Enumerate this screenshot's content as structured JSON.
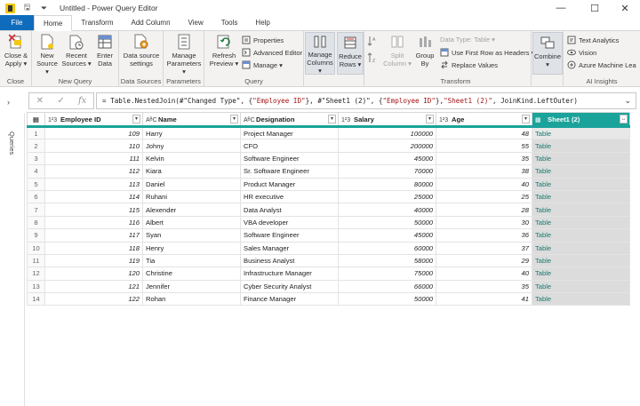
{
  "window": {
    "title": "Untitled - Power Query Editor",
    "minimize": "—",
    "maximize": "☐",
    "close": "✕"
  },
  "tabs": [
    {
      "label": "File"
    },
    {
      "label": "Home"
    },
    {
      "label": "Transform"
    },
    {
      "label": "Add Column"
    },
    {
      "label": "View"
    },
    {
      "label": "Tools"
    },
    {
      "label": "Help"
    }
  ],
  "ribbon": {
    "close_group": {
      "label": "Close",
      "close_apply": "Close &",
      "close_apply2": "Apply ▾"
    },
    "new_query_group": {
      "label": "New Query",
      "new_source": "New",
      "new_source2": "Source ▾",
      "recent": "Recent",
      "recent2": "Sources ▾",
      "enter": "Enter",
      "enter2": "Data"
    },
    "data_sources_group": {
      "label": "Data Sources",
      "settings": "Data source",
      "settings2": "settings"
    },
    "parameters_group": {
      "label": "Parameters",
      "manage": "Manage",
      "manage2": "Parameters ▾"
    },
    "query_group": {
      "label": "Query",
      "refresh": "Refresh",
      "refresh2": "Preview ▾",
      "properties": "Properties",
      "advanced": "Advanced Editor",
      "manage": "Manage ▾"
    },
    "manage_columns": {
      "l1": "Manage",
      "l2": "Columns ▾"
    },
    "reduce_rows": {
      "l1": "Reduce",
      "l2": "Rows ▾"
    },
    "transform_group": {
      "label": "Transform",
      "split": "Split",
      "split2": "Column ▾",
      "group": "Group",
      "group2": "By",
      "data_type": "Data Type: Table ▾",
      "first_row": "Use First Row as Headers ▾",
      "replace": "Replace Values"
    },
    "combine": {
      "l1": "Combine",
      "l2": "▾"
    },
    "ai_group": {
      "label": "AI Insights",
      "text_analytics": "Text Analytics",
      "vision": "Vision",
      "azure_ml": "Azure Machine Lea"
    }
  },
  "formula_bar": {
    "cancel": "✕",
    "accept": "✓",
    "fx": "fx",
    "p1": "= Table.NestedJoin(#\"Changed Type\", {",
    "s1": "\"Employee ID\"",
    "p2": "}, #\"Sheet1 (2)\", {",
    "s2": "\"Employee ID\"",
    "p3": "}, ",
    "s3": "\"Sheet1 (2)\"",
    "p4": ", JoinKind.LeftOuter)"
  },
  "side_panel": {
    "toggle": "›",
    "label": "Queries"
  },
  "grid": {
    "columns": [
      {
        "type": "1²3",
        "name": "Employee ID"
      },
      {
        "type": "AᴮC",
        "name": "Name"
      },
      {
        "type": "AᴮC",
        "name": "Designation"
      },
      {
        "type": "1²3",
        "name": "Salary"
      },
      {
        "type": "1²3",
        "name": "Age"
      },
      {
        "type": "▦",
        "name": "Sheet1 (2)"
      }
    ],
    "rows": [
      {
        "n": "1",
        "id": "109",
        "name": "Harry",
        "designation": "Project Manager",
        "salary": "100000",
        "age": "48",
        "sheet": "Table"
      },
      {
        "n": "2",
        "id": "110",
        "name": "Johny",
        "designation": "CFO",
        "salary": "200000",
        "age": "55",
        "sheet": "Table"
      },
      {
        "n": "3",
        "id": "111",
        "name": "Kelvin",
        "designation": "Software Engineer",
        "salary": "45000",
        "age": "35",
        "sheet": "Table"
      },
      {
        "n": "4",
        "id": "112",
        "name": "Kiara",
        "designation": "Sr. Software Engineer",
        "salary": "70000",
        "age": "38",
        "sheet": "Table"
      },
      {
        "n": "5",
        "id": "113",
        "name": "Daniel",
        "designation": "Product Manager",
        "salary": "80000",
        "age": "40",
        "sheet": "Table"
      },
      {
        "n": "6",
        "id": "114",
        "name": "Ruhani",
        "designation": "HR executive",
        "salary": "25000",
        "age": "25",
        "sheet": "Table"
      },
      {
        "n": "7",
        "id": "115",
        "name": "Alexender",
        "designation": "Data Analyst",
        "salary": "40000",
        "age": "28",
        "sheet": "Table"
      },
      {
        "n": "8",
        "id": "116",
        "name": "Albert",
        "designation": "VBA developer",
        "salary": "50000",
        "age": "30",
        "sheet": "Table"
      },
      {
        "n": "9",
        "id": "117",
        "name": "Syan",
        "designation": "Software Engineer",
        "salary": "45000",
        "age": "36",
        "sheet": "Table"
      },
      {
        "n": "10",
        "id": "118",
        "name": "Henry",
        "designation": "Sales Manager",
        "salary": "60000",
        "age": "37",
        "sheet": "Table"
      },
      {
        "n": "11",
        "id": "119",
        "name": "Tia",
        "designation": "Business Analyst",
        "salary": "58000",
        "age": "29",
        "sheet": "Table"
      },
      {
        "n": "12",
        "id": "120",
        "name": "Christine",
        "designation": "Infrastructure Manager",
        "salary": "75000",
        "age": "40",
        "sheet": "Table"
      },
      {
        "n": "13",
        "id": "121",
        "name": "Jennifer",
        "designation": "Cyber Security Analyst",
        "salary": "66000",
        "age": "35",
        "sheet": "Table"
      },
      {
        "n": "14",
        "id": "122",
        "name": "Rohan",
        "designation": "Finance Manager",
        "salary": "50000",
        "age": "41",
        "sheet": "Table"
      }
    ]
  },
  "colors": {
    "accent": "#1aa39a",
    "file_tab": "#0f6cbd",
    "ribbon_bg": "#f3f2f1"
  }
}
